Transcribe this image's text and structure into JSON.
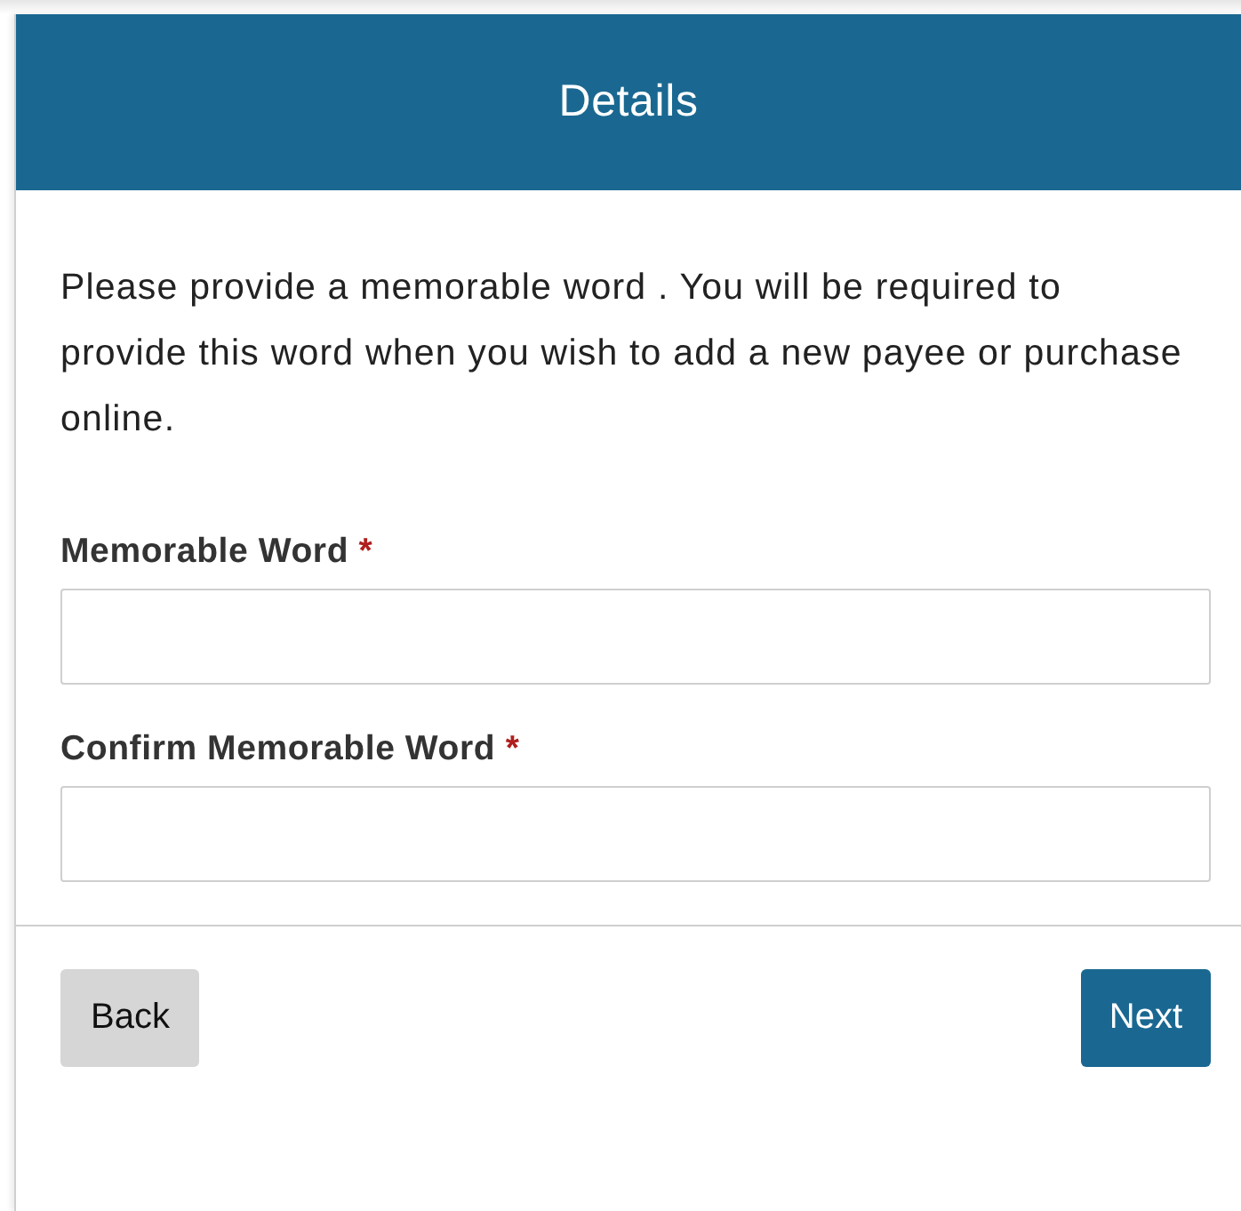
{
  "header": {
    "title": "Details"
  },
  "intro": "Please provide a memorable word . You will be required to provide this word when you wish to add a new payee or purchase online.",
  "fields": [
    {
      "label": "Memorable Word",
      "required_mark": "*"
    },
    {
      "label": "Confirm Memorable Word",
      "required_mark": "*"
    }
  ],
  "buttons": [
    {
      "label": "Back",
      "kind": "secondary"
    },
    {
      "label": "Next",
      "kind": "primary"
    }
  ]
}
